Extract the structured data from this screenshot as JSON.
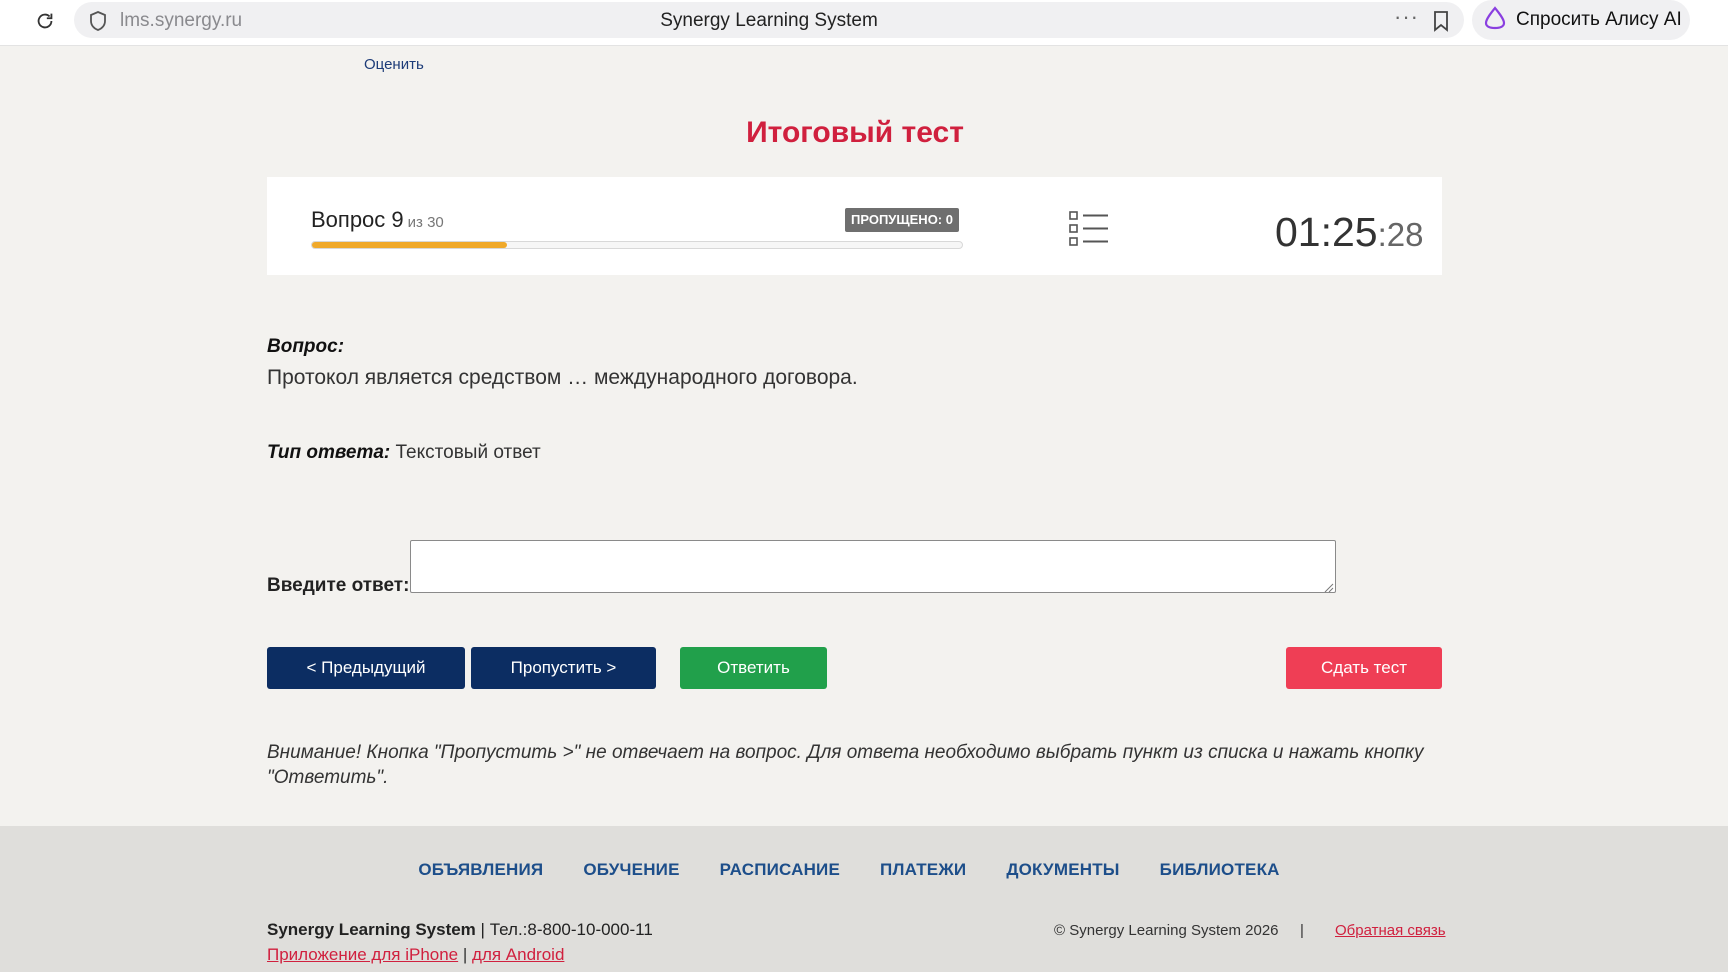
{
  "browser": {
    "url": "lms.synergy.ru",
    "title": "Synergy Learning System",
    "more_label": "···",
    "assistant_label": "Спросить Алису AI"
  },
  "header": {
    "rate_link": "Оценить",
    "test_title": "Итоговый тест"
  },
  "question_panel": {
    "question_label": "Вопрос 9",
    "question_of": "из 30",
    "skipped_badge": "ПРОПУЩЕНО: 0",
    "progress_current": 9,
    "progress_total": 30,
    "progress_color": "#f0a92a",
    "timer_main": "01:25",
    "timer_seconds": ":28"
  },
  "question": {
    "caption": "Вопрос:",
    "text": "Протокол является средством … международного договора.",
    "answer_type_label": "Тип ответа:",
    "answer_type_value": "Текстовый ответ",
    "answer_input_label": "Введите ответ:",
    "answer_value": ""
  },
  "actions": {
    "prev": "< Предыдущий",
    "skip": "Пропустить >",
    "answer": "Ответить",
    "submit": "Сдать тест"
  },
  "warning_text": "Внимание! Кнопка \"Пропустить >\" не отвечает на вопрос. Для ответа необходимо выбрать пункт из списка и нажать кнопку \"Ответить\".",
  "footer": {
    "nav": [
      "ОБЪЯВЛЕНИЯ",
      "ОБУЧЕНИЕ",
      "РАСПИСАНИЕ",
      "ПЛАТЕЖИ",
      "ДОКУМЕНТЫ",
      "БИБЛИОТЕКА"
    ],
    "brand": "Synergy Learning System",
    "brand_sep": "|",
    "phone": "Тел.:8-800-10-000-11",
    "app_iphone": "Приложение для iPhone",
    "app_sep": "|",
    "app_android": "для Android",
    "copyright": "© Synergy Learning System 2026",
    "sep": "|",
    "feedback": "Обратная связь"
  },
  "colors": {
    "brand_red": "#d0203e",
    "navy": "#0c2d62",
    "green": "#21a04b",
    "submit_red": "#ef3e55",
    "link_blue": "#1d4e8a"
  }
}
